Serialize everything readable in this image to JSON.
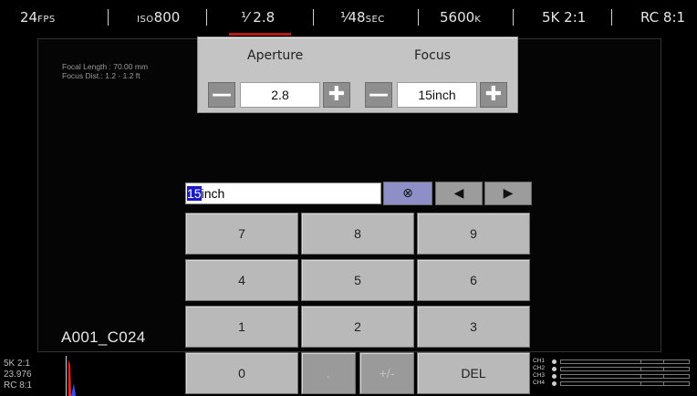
{
  "topbar": {
    "fps_value": "24",
    "fps_unit": "FPS",
    "iso_prefix": "ISO",
    "iso_value": "800",
    "iris": "¹⁄ 2.8",
    "shutter_value": "¹⁄48",
    "shutter_unit": "SEC",
    "wb_value": "5600",
    "wb_unit": "K",
    "format": "5K 2:1",
    "compression": "RC 8:1"
  },
  "lens_info": {
    "focal_length": "Focal Length : 70.00 mm",
    "focus_distance": "Focus Dist.: 1.2 - 1.2 ft"
  },
  "af_panel": {
    "aperture_label": "Aperture",
    "focus_label": "Focus",
    "aperture_value": "2.8",
    "focus_value": "15inch",
    "minus_glyph": "—",
    "plus_glyph": "✚"
  },
  "keypad": {
    "entry_selected": "15",
    "entry_rest": "inch",
    "clear_glyph": "⊗",
    "left_glyph": "◀",
    "right_glyph": "▶",
    "keys": [
      "7",
      "8",
      "9",
      "4",
      "5",
      "6",
      "1",
      "2",
      "3",
      "0",
      ".",
      "+/-",
      "DEL"
    ]
  },
  "clip_name": "A001_C024",
  "meta": {
    "format": "5K 2:1",
    "fps": "23.976",
    "compression": "RC 8:1"
  },
  "audio": {
    "channels": [
      "CH1",
      "CH2",
      "CH3",
      "CH4"
    ]
  },
  "colors": {
    "accent_red": "#b51a1a",
    "selection_blue": "#1a1ac8",
    "histogram_red": "#ff2020",
    "histogram_blue": "#3050ff"
  }
}
